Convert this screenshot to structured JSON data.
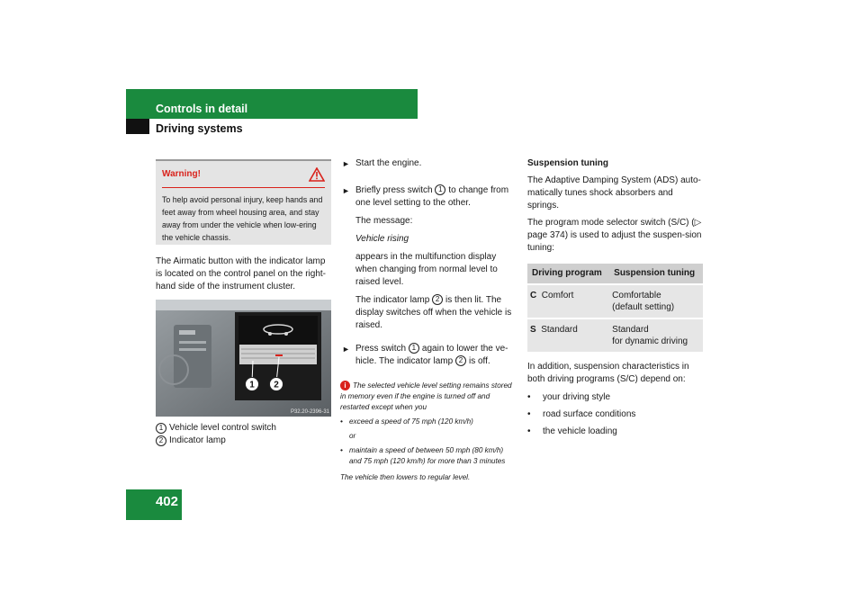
{
  "header": {
    "section": "Controls in detail",
    "subsection": "Driving systems"
  },
  "page_number": "402",
  "warning": {
    "title": "Warning!",
    "icon": "warning-triangle-icon",
    "text": "To help avoid personal injury, keep hands and feet away from wheel housing area, and stay away from under the vehicle when low-ering the vehicle chassis."
  },
  "col1": {
    "intro": "The Airmatic button with the indicator lamp is located on the control panel on the right-hand side of the instrument cluster.",
    "figure_code": "P32.20-2396-31",
    "legend": [
      {
        "num": "1",
        "text": "Vehicle level control switch"
      },
      {
        "num": "2",
        "text": "Indicator lamp"
      }
    ]
  },
  "col2": {
    "step1": "Start the engine.",
    "step2_a": "Briefly press switch",
    "step2_b": "to change from one level setting to the other.",
    "msg_label": "The message:",
    "msg": "Vehicle rising",
    "msg_desc": "appears in the multifunction display when changing from normal level to raised level.",
    "lamp_a": "The indicator lamp",
    "lamp_b": "is then lit. The display switches off when the vehicle is raised.",
    "step3_a": "Press switch",
    "step3_b": "again to lower the ve-hicle. The indicator lamp",
    "step3_c": "is off.",
    "note_intro": "The selected vehicle level setting remains stored in memory even if the engine is turned off and restarted except when you",
    "note_b1": "exceed a speed of 75 mph (120 km/h)",
    "note_or": "or",
    "note_b2": "maintain a speed of between 50 mph (80 km/h) and 75 mph (120 km/h) for more than 3 minutes",
    "note_end": "The vehicle then lowers to regular level."
  },
  "col3": {
    "heading": "Suspension tuning",
    "p1": "The Adaptive Damping System (ADS) auto-matically tunes shock absorbers and springs.",
    "p2": "The program mode selector switch (S/C) (▷ page 374) is used to adjust the suspen-sion tuning:",
    "table": {
      "h1": "Driving program",
      "h2": "Suspension tuning",
      "rows": [
        {
          "code": "C",
          "program": "Comfort",
          "tuning_1": "Comfortable",
          "tuning_2": "(default setting)"
        },
        {
          "code": "S",
          "program": "Standard",
          "tuning_1": "Standard",
          "tuning_2": "for dynamic driving"
        }
      ]
    },
    "p3": "In addition, suspension characteristics in both driving programs (S/C) depend on:",
    "bullets": [
      "your driving style",
      "road surface conditions",
      "the vehicle loading"
    ]
  }
}
